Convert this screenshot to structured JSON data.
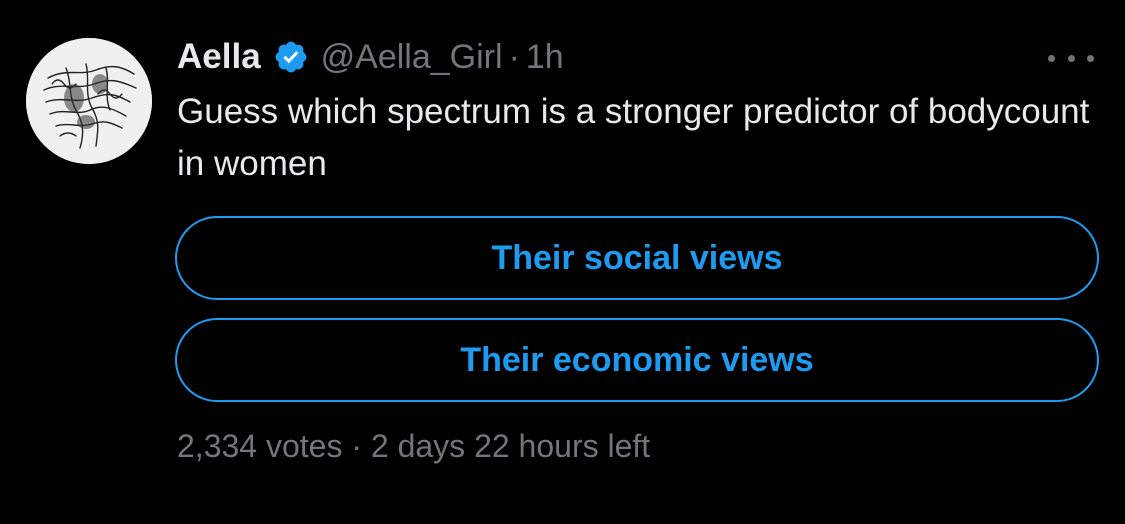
{
  "tweet": {
    "author": {
      "name": "Aella",
      "handle": "@Aella_Girl",
      "separator": "·",
      "time": "1h"
    },
    "text": "Guess which spectrum is a stronger predictor of bodycount in women",
    "poll": {
      "options": [
        {
          "label": "Their social views"
        },
        {
          "label": "Their economic views"
        }
      ],
      "votes": "2,334 votes",
      "separator": "·",
      "time_left": "2 days 22 hours left"
    }
  },
  "icons": {
    "verified": "verified-badge-icon",
    "more": "more-horizontal-icon"
  },
  "colors": {
    "background": "#000000",
    "text_primary": "#e7e9ea",
    "text_secondary": "#71767b",
    "accent": "#1d9bf0"
  }
}
